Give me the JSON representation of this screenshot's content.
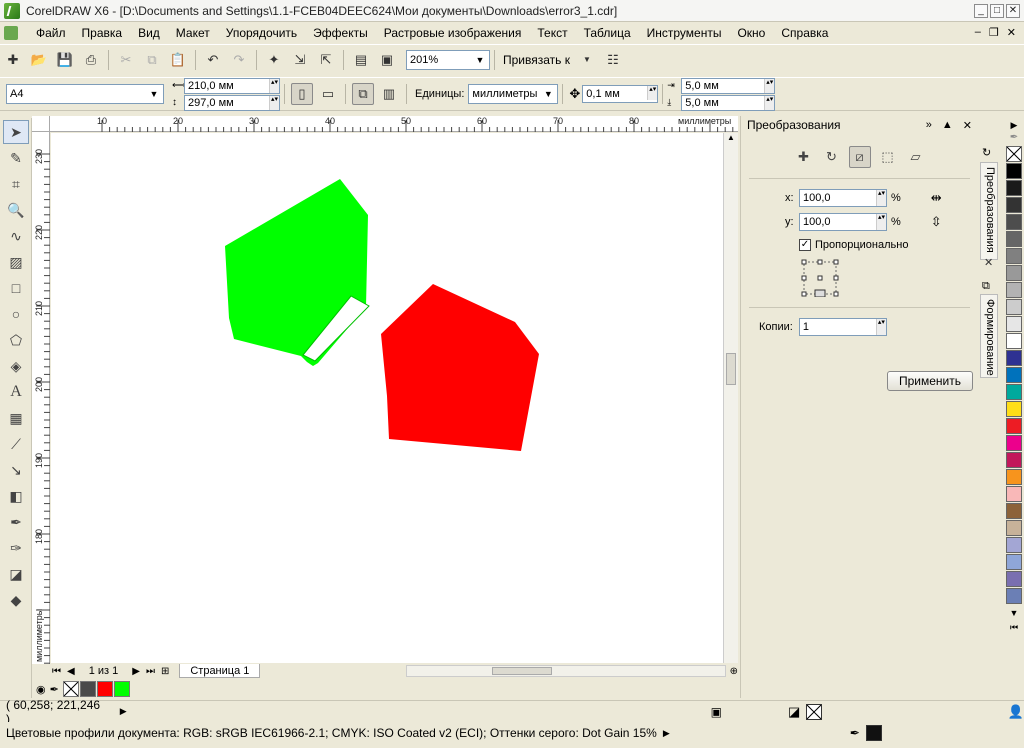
{
  "window": {
    "title": "CorelDRAW X6 - [D:\\Documents and Settings\\1.1-FCEB04DEEC624\\Мои документы\\Downloads\\error3_1.cdr]",
    "minimize_label": "_",
    "maximize_label": "□",
    "close_label": "✕"
  },
  "menu": {
    "items": [
      "Файл",
      "Правка",
      "Вид",
      "Макет",
      "Упорядочить",
      "Эффекты",
      "Растровые изображения",
      "Текст",
      "Таблица",
      "Инструменты",
      "Окно",
      "Справка"
    ],
    "mdi_minimize": "–",
    "mdi_restore": "❐",
    "mdi_close": "✕"
  },
  "toolbar": {
    "zoom_value": "201%",
    "snap_label": "Привязать к"
  },
  "property_bar": {
    "paper_size": "A4",
    "width": "210,0 мм",
    "height": "297,0 мм",
    "units_label": "Единицы:",
    "units_value": "миллиметры",
    "nudge": "0,1 мм",
    "dup_x": "5,0 мм",
    "dup_y": "5,0 мм"
  },
  "ruler": {
    "h_labels": [
      "10",
      "20",
      "30",
      "40",
      "50",
      "60",
      "70",
      "80",
      "миллиметры"
    ],
    "v_labels": [
      "230",
      "220",
      "210",
      "200",
      "190",
      "180",
      "миллиметры"
    ]
  },
  "canvas": {
    "shapes": [
      {
        "name": "green-pentagon",
        "fill": "#00ff00"
      },
      {
        "name": "red-pentagon",
        "fill": "#ff0000"
      }
    ]
  },
  "page_nav": {
    "page_count": "1 из 1",
    "page_tab": "Страница 1"
  },
  "document_palette": {
    "colors": [
      "#4a4a4a",
      "#ff0000",
      "#00ff00"
    ]
  },
  "status": {
    "coordinates": "( 60,258; 221,246 )",
    "color_profiles": "Цветовые профили документа: RGB: sRGB IEC61966-2.1; CMYK: ISO Coated v2 (ECI); Оттенки серого: Dot Gain 15%"
  },
  "docker": {
    "title": "Преобразования",
    "x_label": "x:",
    "x_value": "100,0",
    "y_label": "y:",
    "y_value": "100,0",
    "percent": "%",
    "proportional_label": "Пропорционально",
    "copies_label": "Копии:",
    "copies_value": "1",
    "apply_label": "Применить"
  },
  "docker_tabs": {
    "transform_tab": "Преобразования",
    "shaping_tab": "Формирование"
  },
  "palette": {
    "colors": [
      "#000000",
      "#1a1a1a",
      "#333333",
      "#4d4d4d",
      "#666666",
      "#808080",
      "#999999",
      "#b3b3b3",
      "#cccccc",
      "#e6e6e6",
      "#ffffff",
      "#2e3192",
      "#0072bc",
      "#00a99d",
      "#ffde17",
      "#ed1c24",
      "#ec008c",
      "#c2185b",
      "#f7941d",
      "#f9b8b8",
      "#8c6239",
      "#c7b299",
      "#a3a6d4",
      "#8fa6d8",
      "#7a6fb0",
      "#6b7fb5"
    ]
  }
}
